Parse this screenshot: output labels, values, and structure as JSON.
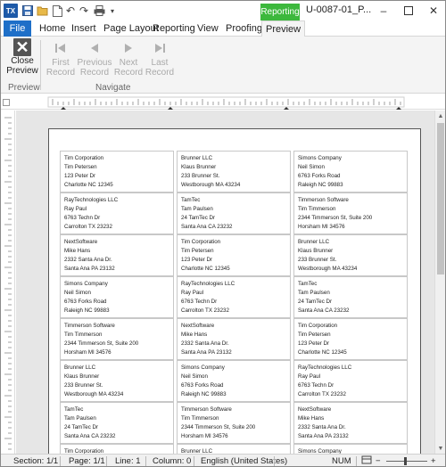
{
  "window": {
    "title": "U-0087-01_P..."
  },
  "quick_access": {
    "app_icon_text": "TX",
    "icons": [
      "save-icon",
      "folder-open-icon",
      "new-document-icon",
      "undo-icon",
      "redo-icon",
      "print-icon"
    ]
  },
  "context_tab": {
    "label": "Reporting",
    "color": "#3cb83c"
  },
  "tabs": [
    {
      "label": "File"
    },
    {
      "label": "Home"
    },
    {
      "label": "Insert"
    },
    {
      "label": "Page Layout"
    },
    {
      "label": "Reporting"
    },
    {
      "label": "View"
    },
    {
      "label": "Proofing"
    },
    {
      "label": "Preview"
    }
  ],
  "ribbon": {
    "preview_group": {
      "label": "Preview",
      "close": {
        "line1": "Close",
        "line2": "Preview"
      }
    },
    "navigate_group": {
      "label": "Navigate",
      "buttons": [
        {
          "line1": "First",
          "line2": "Record"
        },
        {
          "line1": "Previous",
          "line2": "Record"
        },
        {
          "line1": "Next",
          "line2": "Record"
        },
        {
          "line1": "Last",
          "line2": "Record"
        }
      ]
    }
  },
  "labels": [
    [
      "Tim Corporation",
      "Tim Petersen",
      "123 Peter Dr",
      "Charlotte NC 12345"
    ],
    [
      "Brunner LLC",
      "Klaus Brunner",
      "233 Brunner St.",
      "Westborough MA 43234"
    ],
    [
      "Simons Company",
      "Neil Simon",
      "6763 Forks Road",
      "Raleigh NC 99883"
    ],
    [
      "RayTechnologies LLC",
      "Ray Paul",
      "6763 Techn Dr",
      "Carrolton TX 23232"
    ],
    [
      "TamTec",
      "Tam Paulsen",
      "24 TamTec Dr",
      "Santa Ana CA 23232"
    ],
    [
      "Timmerson Software",
      "Tim Timmerson",
      "2344 Timmerson St, Suite 200",
      "Horsham MI 34576"
    ],
    [
      "NextSoftware",
      "Mike Hans",
      "2332 Santa Ana Dr.",
      "Santa Ana PA 23132"
    ],
    [
      "Tim Corporation",
      "Tim Petersen",
      "123 Peter Dr",
      "Charlotte NC 12345"
    ],
    [
      "Brunner LLC",
      "Klaus Brunner",
      "233 Brunner St.",
      "Westborough MA 43234"
    ],
    [
      "Simons Company",
      "Neil Simon",
      "6763 Forks Road",
      "Raleigh NC 99883"
    ],
    [
      "RayTechnologies LLC",
      "Ray Paul",
      "6763 Techn Dr",
      "Carrolton TX 23232"
    ],
    [
      "TamTec",
      "Tam Paulsen",
      "24 TamTec Dr",
      "Santa Ana CA 23232"
    ],
    [
      "Timmerson Software",
      "Tim Timmerson",
      "2344 Timmerson St, Suite 200",
      "Horsham MI 34576"
    ],
    [
      "NextSoftware",
      "Mike Hans",
      "2332 Santa Ana Dr.",
      "Santa Ana PA 23132"
    ],
    [
      "Tim Corporation",
      "Tim Petersen",
      "123 Peter Dr",
      "Charlotte NC 12345"
    ],
    [
      "Brunner LLC",
      "Klaus Brunner",
      "233 Brunner St.",
      "Westborough MA 43234"
    ],
    [
      "Simons Company",
      "Neil Simon",
      "6763 Forks Road",
      "Raleigh NC 99883"
    ],
    [
      "RayTechnologies LLC",
      "Ray Paul",
      "6763 Techn Dr",
      "Carrolton TX 23232"
    ],
    [
      "TamTec",
      "Tam Paulsen",
      "24 TamTec Dr",
      "Santa Ana CA 23232"
    ],
    [
      "Timmerson Software",
      "Tim Timmerson",
      "2344 Timmerson St, Suite 200",
      "Horsham MI 34576"
    ],
    [
      "NextSoftware",
      "Mike Hans",
      "2332 Santa Ana Dr.",
      "Santa Ana PA 23132"
    ],
    [
      "Tim Corporation",
      "",
      "",
      ""
    ],
    [
      "Brunner LLC",
      "",
      "",
      ""
    ],
    [
      "Simons Company",
      "",
      "",
      ""
    ]
  ],
  "status": {
    "section": "Section: 1/1",
    "page": "Page: 1/1",
    "line": "Line: 1",
    "column": "Column: 0",
    "language": "English (United States)",
    "num": "NUM"
  }
}
